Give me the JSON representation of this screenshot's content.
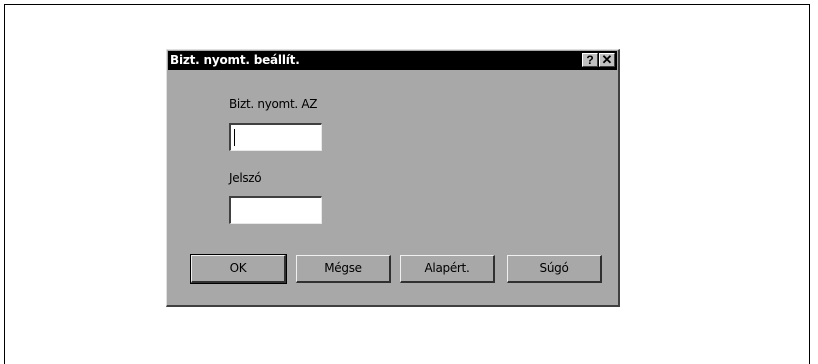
{
  "dialog": {
    "title": "Bizt. nyomt. beállít.",
    "help_glyph": "?",
    "close_glyph": "✕"
  },
  "fields": {
    "id_label": "Bizt. nyomt. AZ",
    "id_value": "",
    "password_label": "Jelszó",
    "password_value": ""
  },
  "buttons": {
    "ok": "OK",
    "cancel": "Mégse",
    "default": "Alapért.",
    "help": "Súgó"
  },
  "icons": [
    "help-icon",
    "close-icon"
  ]
}
